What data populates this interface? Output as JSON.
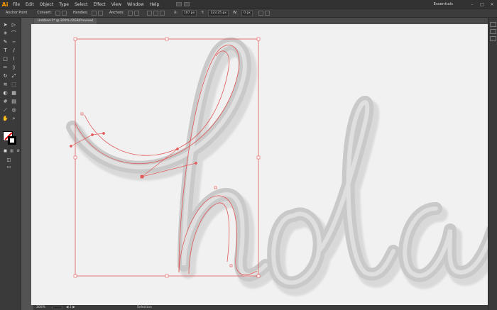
{
  "app": {
    "logo": "Ai"
  },
  "menu": [
    "File",
    "Edit",
    "Object",
    "Type",
    "Select",
    "Effect",
    "View",
    "Window",
    "Help"
  ],
  "workspace": "Essentials",
  "window_controls": [
    "–",
    "□",
    "✕"
  ],
  "control_bar": {
    "tool_label": "Anchor Point",
    "convert_label": "Convert:",
    "handles_label": "Handles:",
    "anchors_label": "Anchors:",
    "x_value": "107 px",
    "y_value": "123.25 px",
    "w_value": "0 px"
  },
  "document": {
    "tab_label": "Untitled-1* @ 200% (RGB/Preview)"
  },
  "status": {
    "zoom": "200%",
    "page": "1",
    "tool": "Selection"
  },
  "artwork": {
    "word": "hola",
    "path_color": "#e05a5a"
  }
}
